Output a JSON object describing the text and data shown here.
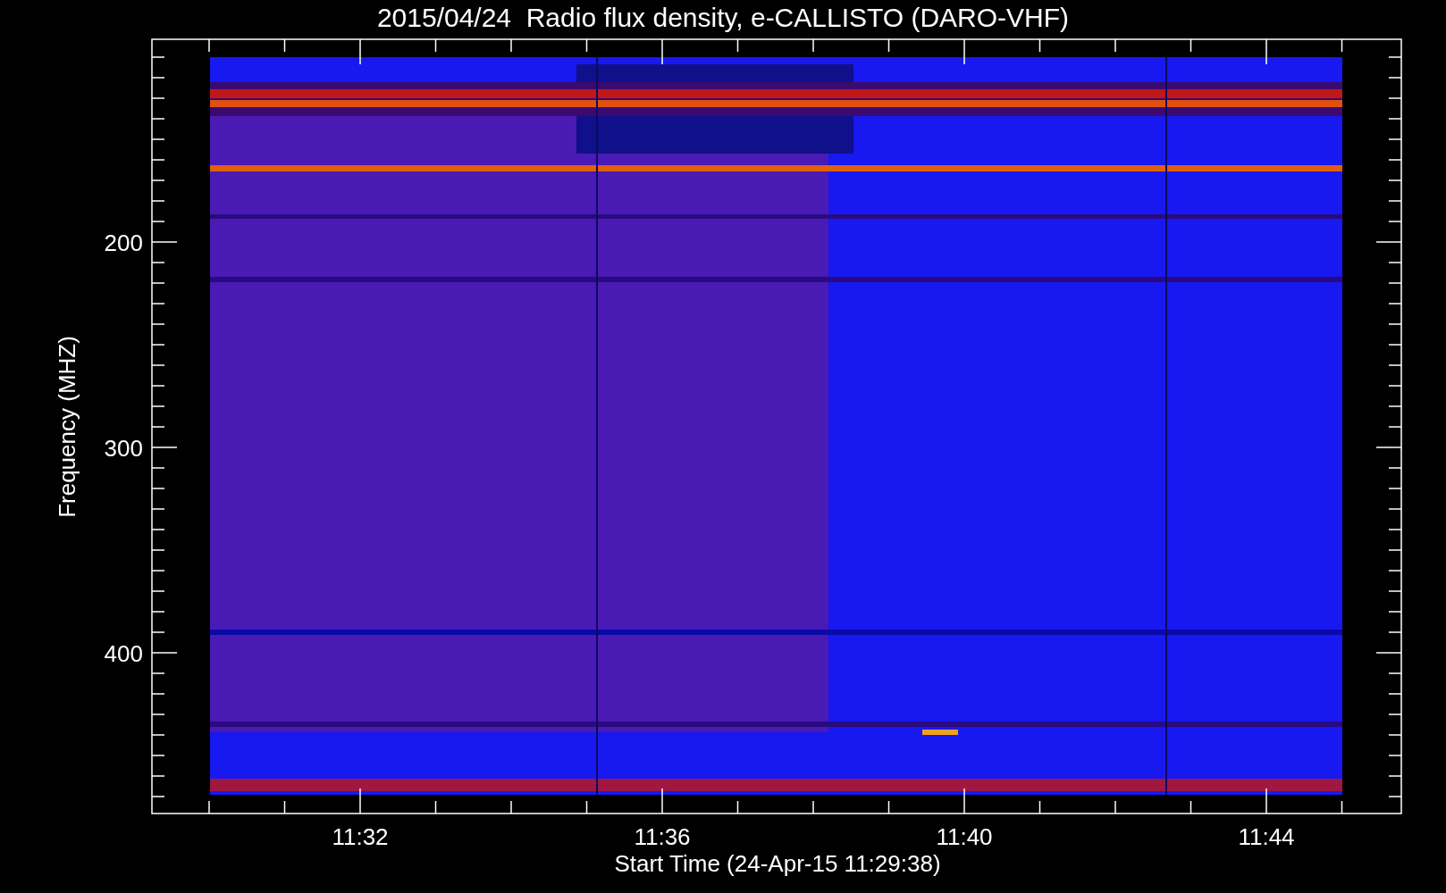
{
  "title": "2015/04/24  Radio flux density, e-CALLISTO (DARO-VHF)",
  "y_axis": {
    "label": "Frequency (MHZ)",
    "ticks": [
      "200",
      "300",
      "400"
    ]
  },
  "x_axis": {
    "label": "Start Time (24-Apr-15 11:29:38)",
    "ticks": [
      "11:32",
      "11:36",
      "11:40",
      "11:44"
    ]
  }
}
